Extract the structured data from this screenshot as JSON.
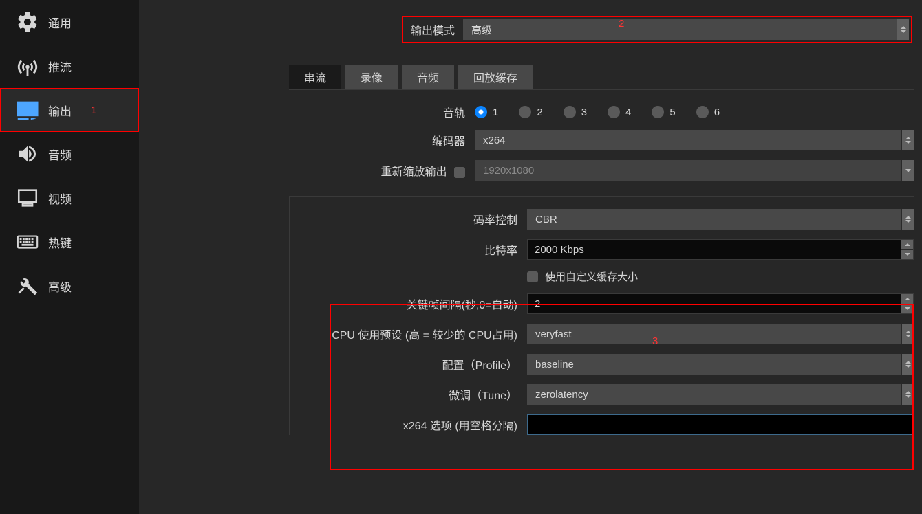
{
  "sidebar": {
    "items": [
      {
        "label": "通用"
      },
      {
        "label": "推流"
      },
      {
        "label": "输出",
        "annotation": "1"
      },
      {
        "label": "音频"
      },
      {
        "label": "视频"
      },
      {
        "label": "热键"
      },
      {
        "label": "高级"
      }
    ]
  },
  "topbar": {
    "mode_label": "输出模式",
    "mode_value": "高级",
    "annotation": "2"
  },
  "tabs": {
    "items": [
      {
        "label": "串流"
      },
      {
        "label": "录像"
      },
      {
        "label": "音频"
      },
      {
        "label": "回放缓存"
      }
    ]
  },
  "form": {
    "track_label": "音轨",
    "tracks": [
      "1",
      "2",
      "3",
      "4",
      "5",
      "6"
    ],
    "encoder_label": "编码器",
    "encoder_value": "x264",
    "rescale_label": "重新缩放输出",
    "rescale_placeholder": "1920x1080",
    "rate_control_label": "码率控制",
    "rate_control_value": "CBR",
    "bitrate_label": "比特率",
    "bitrate_value": "2000 Kbps",
    "custom_buf_label": "使用自定义缓存大小",
    "keyframe_label": "关键帧间隔(秒,0=自动)",
    "keyframe_value": "2",
    "cpu_preset_label": "CPU 使用预设 (高 = 较少的 CPU占用)",
    "cpu_preset_value": "veryfast",
    "profile_label": "配置（Profile）",
    "profile_value": "baseline",
    "tune_label": "微调（Tune）",
    "tune_value": "zerolatency",
    "x264opts_label": "x264 选项 (用空格分隔)",
    "annotation3": "3"
  }
}
